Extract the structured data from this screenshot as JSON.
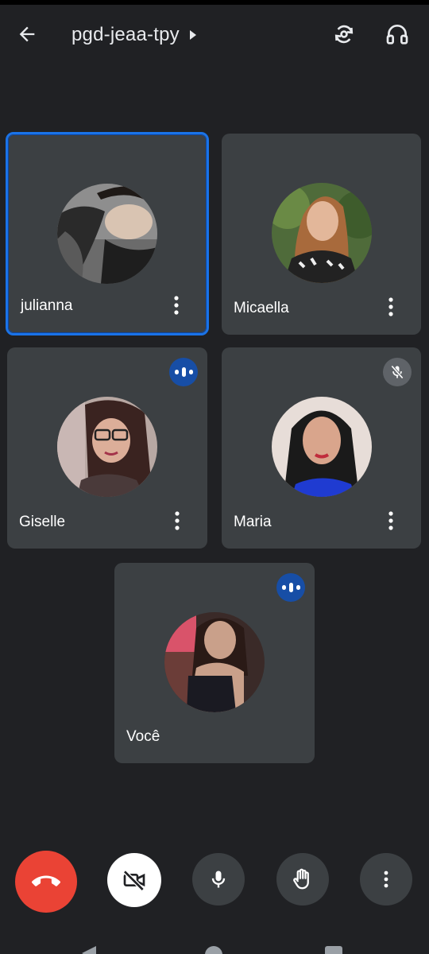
{
  "meeting": {
    "code": "pgd-jeaa-tpy"
  },
  "icons": {
    "back": "arrow-left",
    "title_chevron": "triangle-right",
    "camera_flip": "camera-flip",
    "audio_output": "headphones",
    "participant_menu": "vertical-dots",
    "speaking": "speaking-waveform",
    "muted": "mic-off",
    "hang_up": "phone-hangup",
    "camera_off": "video-off",
    "mic": "microphone",
    "raise_hand": "hand",
    "more_options": "vertical-dots"
  },
  "participants": [
    {
      "name": "julianna",
      "active_speaker": true,
      "status": "none"
    },
    {
      "name": "Micaella",
      "active_speaker": false,
      "status": "none"
    },
    {
      "name": "Giselle",
      "active_speaker": false,
      "status": "speaking"
    },
    {
      "name": "Maria",
      "active_speaker": false,
      "status": "muted"
    },
    {
      "name": "Você",
      "active_speaker": false,
      "status": "speaking"
    }
  ],
  "colors": {
    "background": "#202124",
    "tile": "#3c4043",
    "active_border": "#1a73e8",
    "speaking_badge": "#174ea6",
    "hangup": "#ea4335",
    "text": "#ffffff"
  }
}
